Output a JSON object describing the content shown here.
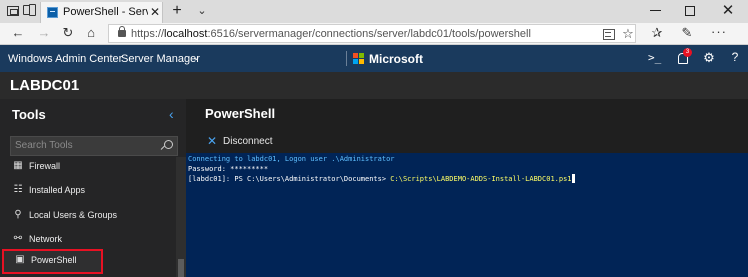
{
  "browser": {
    "tab_title": "PowerShell - Server Manager",
    "tab_close": "✕",
    "new_tab": "+",
    "url_prefix": "https://",
    "url_host": "localhost",
    "url_rest": ":6516/servermanager/connections/server/labdc01/tools/powershell"
  },
  "header": {
    "app_name": "Windows Admin Center",
    "server_manager_label": "Server Manager",
    "brand": "Microsoft",
    "notification_count": "3"
  },
  "server": {
    "name": "LABDC01"
  },
  "sidebar": {
    "title": "Tools",
    "search_placeholder": "Search Tools",
    "items": [
      {
        "label": "Firewall",
        "icon": "firewall-icon",
        "selected": false
      },
      {
        "label": "Installed Apps",
        "icon": "installed-apps-icon",
        "selected": false
      },
      {
        "label": "Local Users & Groups",
        "icon": "users-groups-icon",
        "selected": false
      },
      {
        "label": "Network",
        "icon": "network-icon",
        "selected": false
      },
      {
        "label": "PowerShell",
        "icon": "powershell-icon",
        "selected": true
      }
    ]
  },
  "main": {
    "title": "PowerShell",
    "disconnect_label": "Disconnect"
  },
  "console": {
    "line1": "Connecting to labdc01, Logon user .\\Administrator",
    "line2": "Password: *********",
    "prompt": "[labdc01]: PS C:\\Users\\Administrator\\Documents> ",
    "command": "C:\\Scripts\\LABDEMO-ADDS-Install-LABDC01.ps1"
  },
  "colors": {
    "header_bg": "#1a3a5d",
    "console_bg": "#012456",
    "accent": "#4aa3f0",
    "selection_outline": "#e81123"
  }
}
